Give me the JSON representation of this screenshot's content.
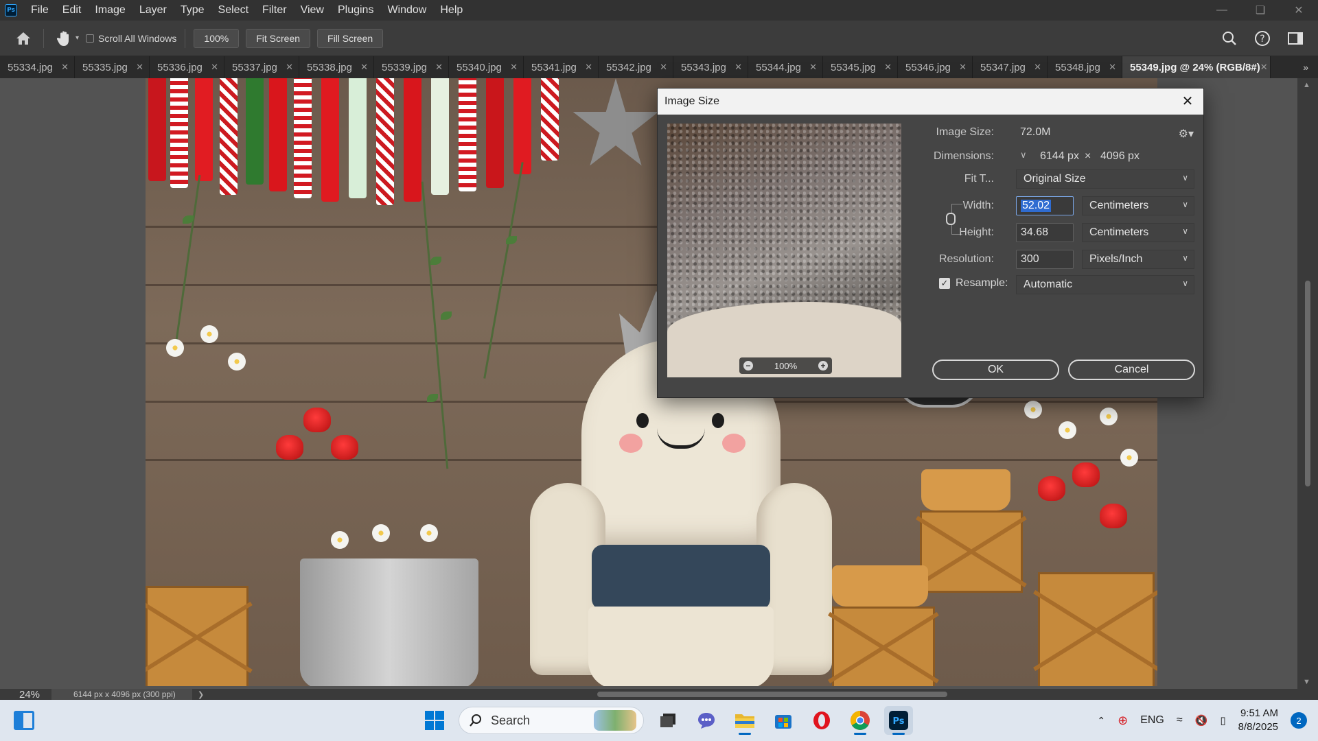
{
  "app": {
    "logo": "Ps",
    "menu": [
      "File",
      "Edit",
      "Image",
      "Layer",
      "Type",
      "Select",
      "Filter",
      "View",
      "Plugins",
      "Window",
      "Help"
    ]
  },
  "options_bar": {
    "scroll_all_windows": "Scroll All Windows",
    "zoom": "100%",
    "fit_screen": "Fit Screen",
    "fill_screen": "Fill Screen"
  },
  "tabs": [
    {
      "label": "55334.jpg"
    },
    {
      "label": "55335.jpg"
    },
    {
      "label": "55336.jpg"
    },
    {
      "label": "55337.jpg"
    },
    {
      "label": "55338.jpg"
    },
    {
      "label": "55339.jpg"
    },
    {
      "label": "55340.jpg"
    },
    {
      "label": "55341.jpg"
    },
    {
      "label": "55342.jpg"
    },
    {
      "label": "55343.jpg"
    },
    {
      "label": "55344.jpg"
    },
    {
      "label": "55345.jpg"
    },
    {
      "label": "55346.jpg"
    },
    {
      "label": "55347.jpg"
    },
    {
      "label": "55348.jpg"
    },
    {
      "label": "55349.jpg @ 24% (RGB/8#)",
      "active": true
    }
  ],
  "status": {
    "zoom": "24%",
    "doc_info": "6144 px x 4096 px (300 ppi)"
  },
  "dialog": {
    "title": "Image Size",
    "image_size_label": "Image Size:",
    "image_size_value": "72.0M",
    "dimensions_label": "Dimensions:",
    "dim_width": "6144 px",
    "dim_times": "×",
    "dim_height": "4096 px",
    "fit_to_label": "Fit T...",
    "fit_to_value": "Original Size",
    "width_label": "Width:",
    "width_value": "52.02",
    "width_unit": "Centimeters",
    "height_label": "Height:",
    "height_value": "34.68",
    "height_unit": "Centimeters",
    "resolution_label": "Resolution:",
    "resolution_value": "300",
    "resolution_unit": "Pixels/Inch",
    "resample_label": "Resample:",
    "resample_checked": true,
    "resample_value": "Automatic",
    "preview_zoom": "100%",
    "ok": "OK",
    "cancel": "Cancel"
  },
  "taskbar": {
    "search_placeholder": "Search",
    "language": "ENG",
    "time": "9:51 AM",
    "date": "8/8/2025",
    "notifications": "2"
  }
}
